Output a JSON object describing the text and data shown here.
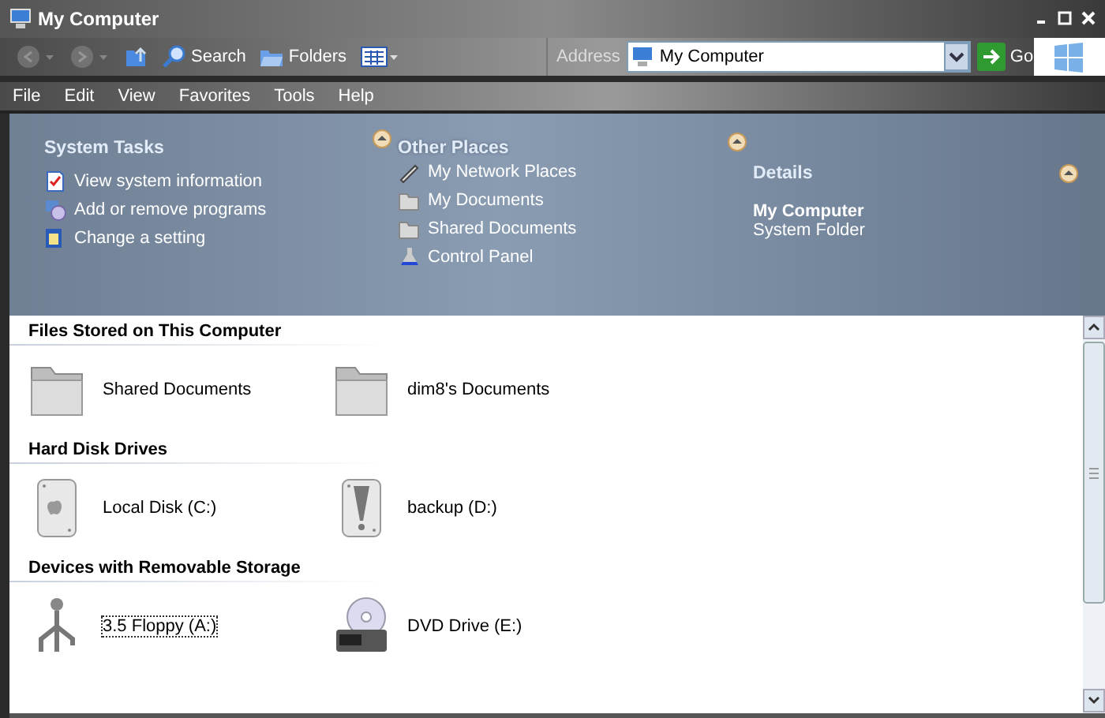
{
  "window": {
    "title": "My Computer"
  },
  "toolbar": {
    "buttons": [
      {
        "kind": "back",
        "disabled": true
      },
      {
        "kind": "forward",
        "disabled": true
      },
      {
        "kind": "up",
        "disabled": false
      },
      {
        "kind": "search",
        "label": "Search",
        "disabled": false
      },
      {
        "kind": "folders",
        "label": "Folders",
        "disabled": false
      },
      {
        "kind": "views",
        "disabled": false
      }
    ]
  },
  "address": {
    "label": "Address",
    "value": "My Computer",
    "go": "Go"
  },
  "menu": [
    "File",
    "Edit",
    "View",
    "Favorites",
    "Tools",
    "Help"
  ],
  "task_pane": [
    {
      "title": "System Tasks",
      "expanded": true,
      "items": [
        {
          "kind": "document",
          "label": "View system information"
        },
        {
          "kind": "disc",
          "label": "Add or remove programs"
        },
        {
          "kind": "window",
          "label": "Change a setting"
        }
      ]
    },
    {
      "title": "Other Places",
      "expanded": true,
      "items": [
        {
          "kind": "pencil",
          "label": "My Network Places"
        },
        {
          "kind": "folder",
          "label": "My Documents"
        },
        {
          "kind": "folder",
          "label": "Shared Documents"
        },
        {
          "kind": "flask",
          "label": "Control Panel"
        }
      ]
    },
    {
      "title": "Details",
      "expanded": true,
      "name": "My Computer",
      "type": "System Folder"
    }
  ],
  "groups": [
    {
      "title": "Files Stored on This Computer",
      "items": [
        {
          "kind": "folder",
          "label": "Shared Documents",
          "selected": false
        },
        {
          "kind": "folder",
          "label": "dim8's Documents",
          "selected": false
        }
      ]
    },
    {
      "title": "Hard Disk Drives",
      "items": [
        {
          "kind": "drive",
          "label": "Local Disk (C:)",
          "selected": false
        },
        {
          "kind": "drive-alert",
          "label": "backup (D:)",
          "selected": false
        }
      ]
    },
    {
      "title": "Devices with Removable Storage",
      "items": [
        {
          "kind": "usb",
          "label": "3.5 Floppy (A:)",
          "selected": true
        },
        {
          "kind": "dvd",
          "label": "DVD Drive (E:)",
          "selected": false
        }
      ]
    }
  ]
}
